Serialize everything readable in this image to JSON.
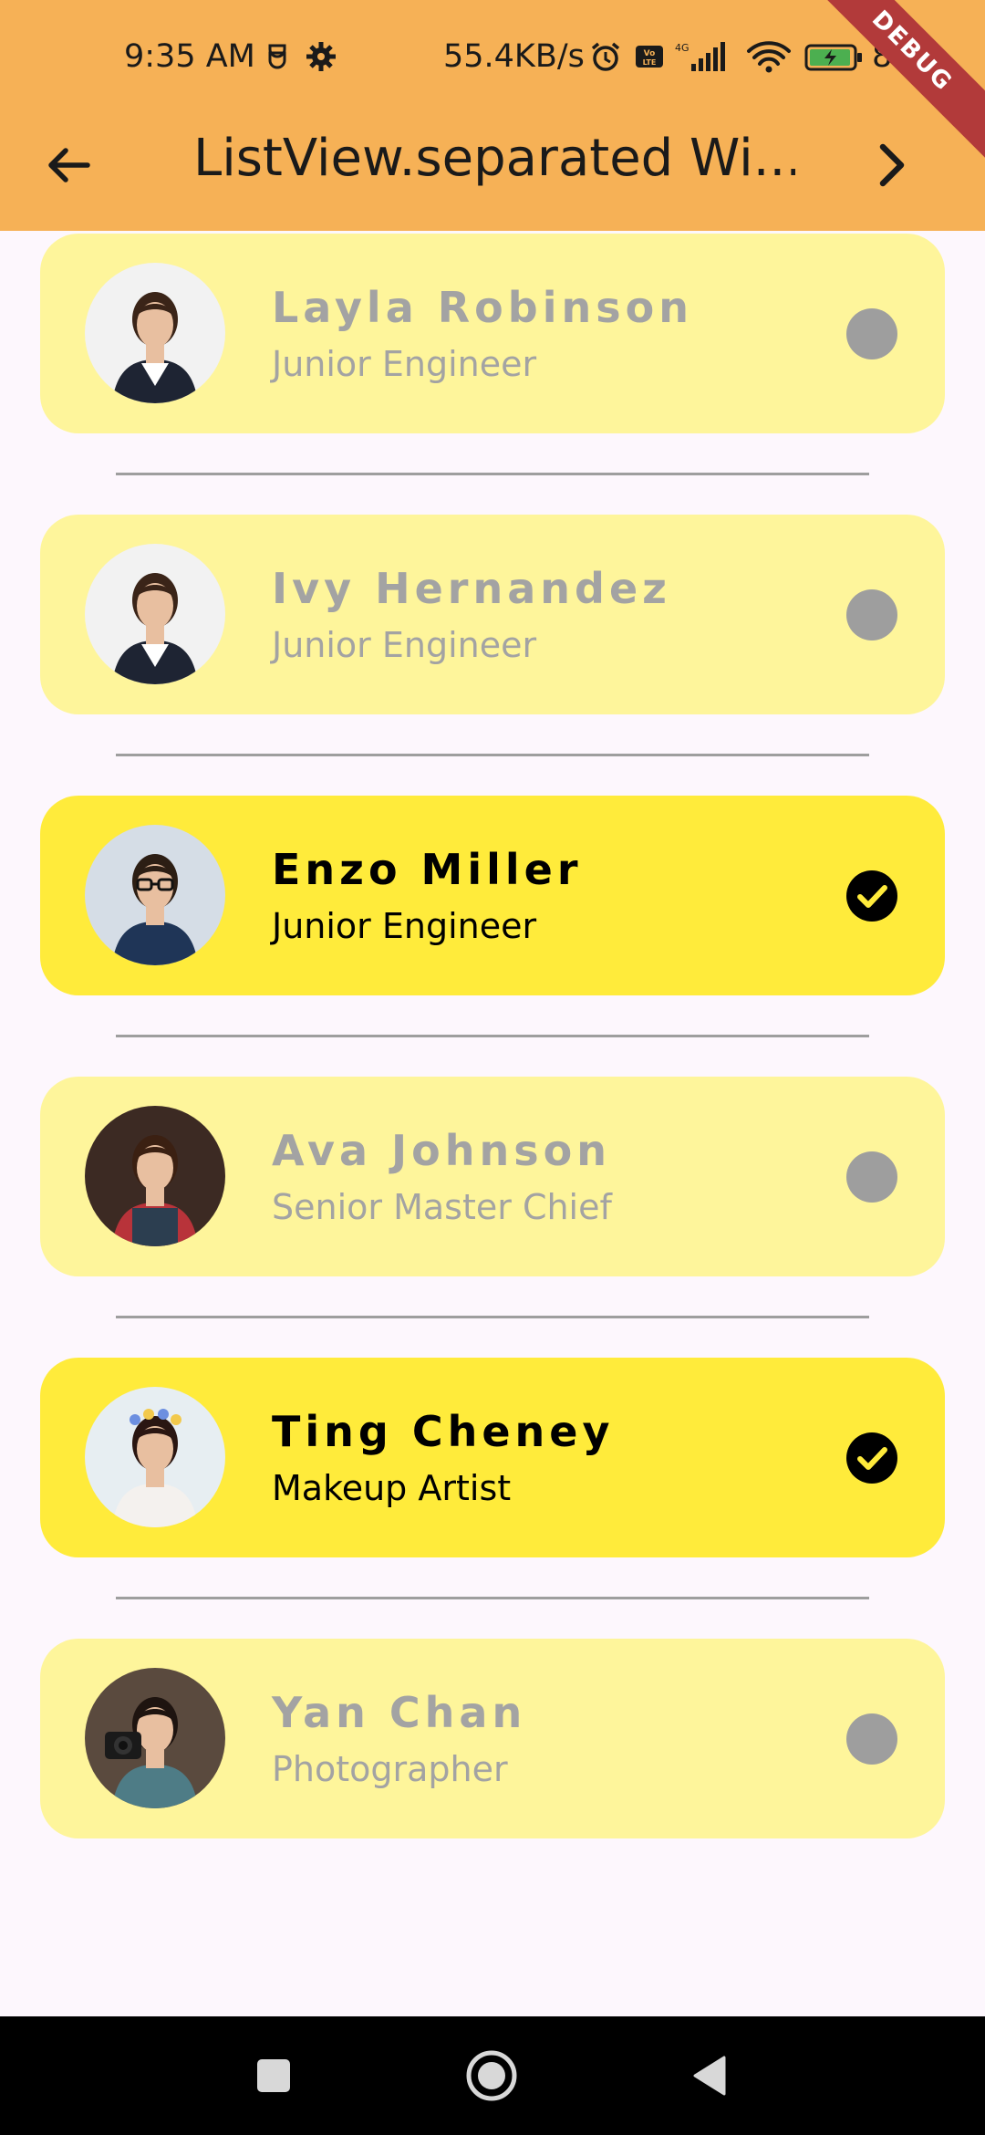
{
  "status_bar": {
    "time": "9:35 AM",
    "network_speed": "55.4KB/s",
    "network_type": "4G",
    "battery": "83"
  },
  "debug_banner": "DEBUG",
  "app_bar": {
    "title": "ListView.separated Wi..."
  },
  "people": [
    {
      "name": "",
      "role": "Junior Engineer",
      "selected": false,
      "avatar": "avatar-woman-business"
    },
    {
      "name": "Layla Robinson",
      "role": "Junior Engineer",
      "selected": false,
      "avatar": "avatar-woman-business"
    },
    {
      "name": "Ivy Hernandez",
      "role": "Junior Engineer",
      "selected": false,
      "avatar": "avatar-woman-business"
    },
    {
      "name": "Enzo Miller",
      "role": "Junior Engineer",
      "selected": true,
      "avatar": "avatar-man-glasses"
    },
    {
      "name": "Ava Johnson",
      "role": "Senior Master Chief",
      "selected": false,
      "avatar": "avatar-woman-chef"
    },
    {
      "name": "Ting Cheney",
      "role": "Makeup Artist",
      "selected": true,
      "avatar": "avatar-woman-flowers"
    },
    {
      "name": "Yan Chan",
      "role": "Photographer",
      "selected": false,
      "avatar": "avatar-woman-camera"
    }
  ],
  "colors": {
    "app_bar": "#F6B156",
    "card_default": "#FEF59B",
    "card_selected": "#FFEB3B",
    "muted_text": "#A3A3A3",
    "radio_default": "#9E9E9E",
    "background": "#FDF7FD"
  },
  "icons": {
    "back": "arrow-back-icon",
    "forward": "chevron-right-icon",
    "selected": "check-circle-icon",
    "unselected": "radio-dot-icon"
  },
  "nav_bar": {
    "buttons": [
      "recents",
      "home",
      "back"
    ]
  }
}
